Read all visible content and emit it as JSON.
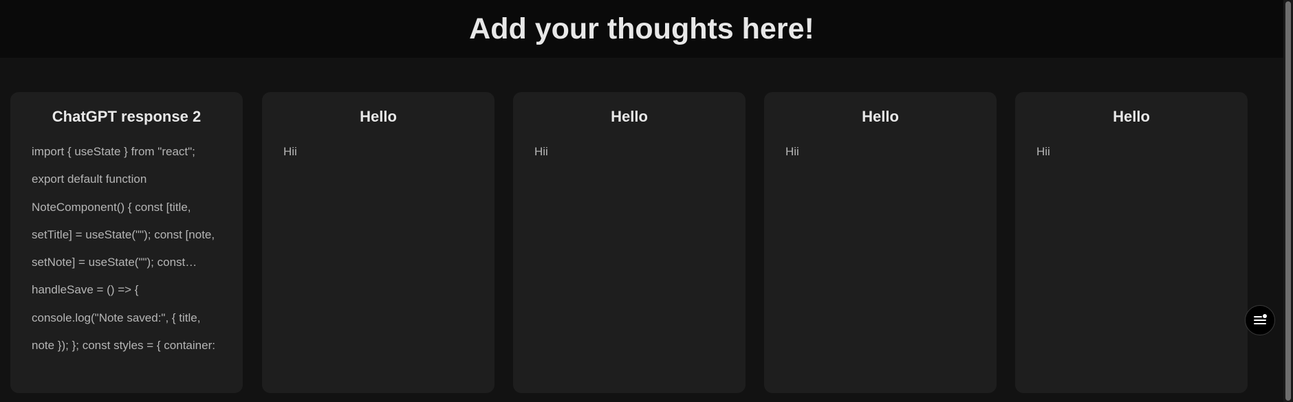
{
  "header": {
    "title": "Add your thoughts here!"
  },
  "notes": [
    {
      "title": "ChatGPT response 2",
      "body": "import { useState } from \"react\"; export default function NoteComponent() { const [title, setTitle] = useState(\"\"); const [note, setNote] = useState(\"\"); const… handleSave = () => { console.log(\"Note saved:\", { title, note }); }; const styles = { container:"
    },
    {
      "title": "Hello",
      "body": "Hii"
    },
    {
      "title": "Hello",
      "body": "Hii"
    },
    {
      "title": "Hello",
      "body": "Hii"
    },
    {
      "title": "Hello",
      "body": "Hii"
    }
  ],
  "fab": {
    "icon": "menu-notification-icon"
  }
}
